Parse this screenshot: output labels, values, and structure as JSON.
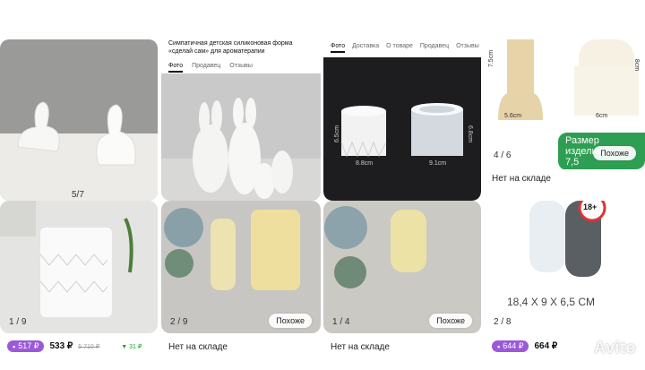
{
  "cards": [
    {
      "counter": "5/7"
    },
    {
      "title": "Симпатичная детская силиконовая форма «сделай сам» для ароматерапии",
      "tabs": [
        "Фото",
        "Продавец",
        "Отзывы"
      ]
    },
    {
      "tabs": [
        "Фото",
        "Доставка",
        "О товаре",
        "Продавец",
        "Отзывы"
      ],
      "dims": [
        "6.5cm",
        "8.8cm",
        "9.1cm",
        "6.8cm"
      ]
    },
    {
      "dims": [
        "7.5cm",
        "8cm",
        "5.6cm",
        "6cm"
      ],
      "banner": "Размер изделия",
      "banner_value": "7,5",
      "counter": "4",
      "counter_total": "6",
      "similar": "Похоже",
      "status": "Нет на складе"
    },
    {
      "counter": "1",
      "counter_total": "9",
      "pill_price": "517 ₽",
      "price": "533 ₽",
      "old_price": "5 710 ₽",
      "bonus": "31 ₽"
    },
    {
      "counter": "2",
      "counter_total": "9",
      "similar": "Похоже",
      "status": "Нет на складе"
    },
    {
      "counter": "1",
      "counter_total": "4",
      "similar": "Похоже",
      "status": "Нет на складе"
    },
    {
      "badge": "18+",
      "size_text": "18,4 X 9 X 6,5 CM",
      "counter": "2",
      "counter_total": "8",
      "pill_price": "644 ₽",
      "price": "664 ₽",
      "watermark": "Avito"
    }
  ]
}
